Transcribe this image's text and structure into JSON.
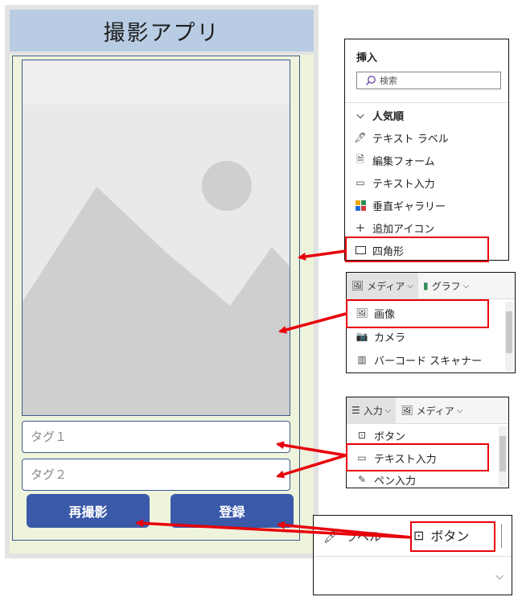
{
  "app": {
    "title": "撮影アプリ",
    "tag1_placeholder": "タグ１",
    "tag2_placeholder": "タグ２",
    "retake_button": "再撮影",
    "register_button": "登録"
  },
  "insert_panel": {
    "title": "挿入",
    "search_placeholder": "検索",
    "section": "人気順",
    "items": [
      {
        "label": "テキスト ラベル",
        "icon": "edit-label-icon"
      },
      {
        "label": "編集フォーム",
        "icon": "form-icon"
      },
      {
        "label": "テキスト入力",
        "icon": "text-input-icon"
      },
      {
        "label": "垂直ギャラリー",
        "icon": "gallery-icon"
      },
      {
        "label": "追加アイコン",
        "icon": "plus-icon"
      },
      {
        "label": "四角形",
        "icon": "rectangle-icon"
      }
    ]
  },
  "media_panel": {
    "tabs": [
      "メディア",
      "グラフ"
    ],
    "items": [
      {
        "label": "画像",
        "icon": "image-icon"
      },
      {
        "label": "カメラ",
        "icon": "camera-icon"
      },
      {
        "label": "バーコード スキャナー",
        "icon": "barcode-icon"
      }
    ]
  },
  "input_panel": {
    "tabs": [
      "入力",
      "メディア"
    ],
    "items": [
      {
        "label": "ボタン",
        "icon": "button-icon"
      },
      {
        "label": "テキスト入力",
        "icon": "text-input-icon"
      },
      {
        "label": "ペン入力",
        "icon": "pen-icon"
      }
    ]
  },
  "ribbon_panel": {
    "label_item": "ラベル",
    "button_item": "ボタン"
  },
  "colors": {
    "header": "#b8cce4",
    "body": "#eef3dc",
    "button": "#3a59a8",
    "highlight": "#e8000b"
  }
}
